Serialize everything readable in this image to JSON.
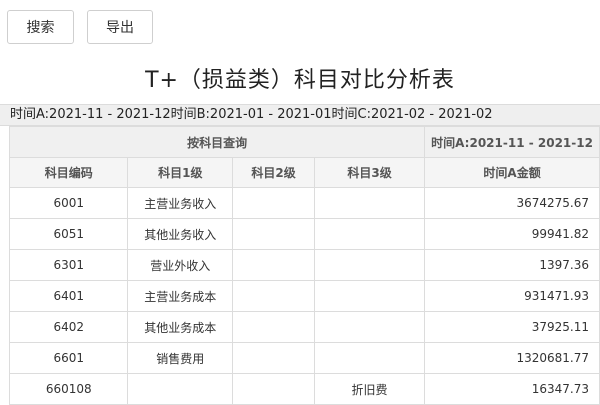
{
  "toolbar": {
    "search_label": "搜索",
    "export_label": "导出"
  },
  "report_title": "T+（损益类）科目对比分析表",
  "range_line": "时间A:2021-11 - 2021-12时间B:2021-01 - 2021-01时间C:2021-02 - 2021-02",
  "table": {
    "group_headers": {
      "query": "按科目查询",
      "time_a": "时间A:2021-11 - 2021-12"
    },
    "columns": [
      "科目编码",
      "科目1级",
      "科目2级",
      "科目3级",
      "时间A金额"
    ],
    "rows": [
      {
        "code": "6001",
        "l1": "主营业务收入",
        "l2": "",
        "l3": "",
        "amount": "3674275.67"
      },
      {
        "code": "6051",
        "l1": "其他业务收入",
        "l2": "",
        "l3": "",
        "amount": "99941.82"
      },
      {
        "code": "6301",
        "l1": "营业外收入",
        "l2": "",
        "l3": "",
        "amount": "1397.36"
      },
      {
        "code": "6401",
        "l1": "主营业务成本",
        "l2": "",
        "l3": "",
        "amount": "931471.93"
      },
      {
        "code": "6402",
        "l1": "其他业务成本",
        "l2": "",
        "l3": "",
        "amount": "37925.11"
      },
      {
        "code": "6601",
        "l1": "销售费用",
        "l2": "",
        "l3": "",
        "amount": "1320681.77"
      },
      {
        "code": "660108",
        "l1": "",
        "l2": "",
        "l3": "折旧费",
        "amount": "16347.73"
      }
    ]
  }
}
